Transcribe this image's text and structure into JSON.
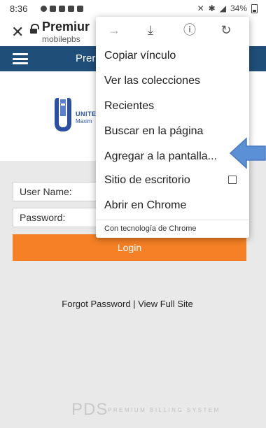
{
  "status_bar": {
    "time": "8:36",
    "battery": "34%"
  },
  "tab_bar": {
    "title": "Premiur",
    "url": "mobilepbs"
  },
  "header": {
    "title": "Prer"
  },
  "logo": {
    "line1": "UNITE",
    "line2": "Maxim"
  },
  "form": {
    "username_label": "User Name:",
    "password_label": "Password:",
    "login_label": "Login"
  },
  "footer": {
    "forgot_password": "Forgot Password",
    "separator": "|",
    "view_full_site": "View Full Site"
  },
  "brand": {
    "pds": "PDS",
    "tagline": "PREMIUM BILLING SYSTEM"
  },
  "menu": {
    "items": [
      "Copiar vínculo",
      "Ver las colecciones",
      "Recientes",
      "Buscar en la página",
      "Agregar a la pantalla...",
      "Sitio de escritorio",
      "Abrir en Chrome"
    ],
    "footer": "Con tecnología de Chrome",
    "toolbar_icons": [
      "forward-icon",
      "download-icon",
      "info-icon",
      "refresh-icon"
    ]
  },
  "colors": {
    "header_bg": "#1f4e79",
    "login_button": "#f58025",
    "callout_arrow": "#5b8fd6"
  }
}
